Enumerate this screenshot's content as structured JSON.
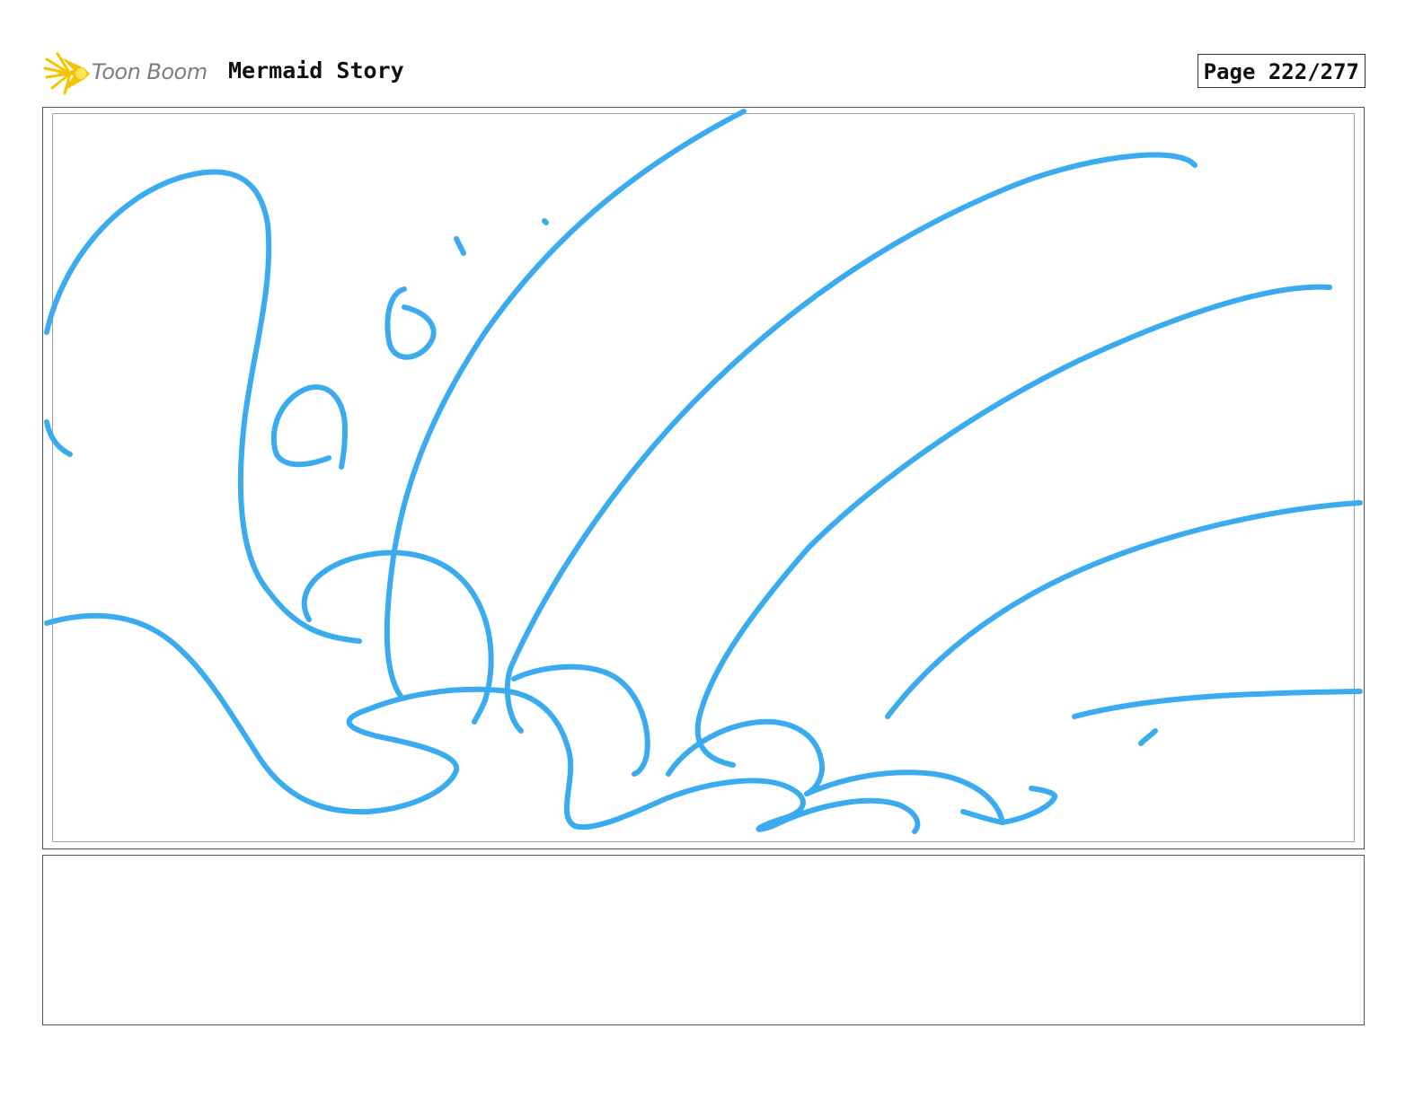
{
  "header": {
    "logo_text": "Toon Boom",
    "title": "Mermaid Story",
    "page_label": "Page 222/277"
  },
  "panel": {
    "sketch_color": "#3aabef",
    "logo_color": "#f5c400"
  },
  "caption": {
    "text": ""
  }
}
